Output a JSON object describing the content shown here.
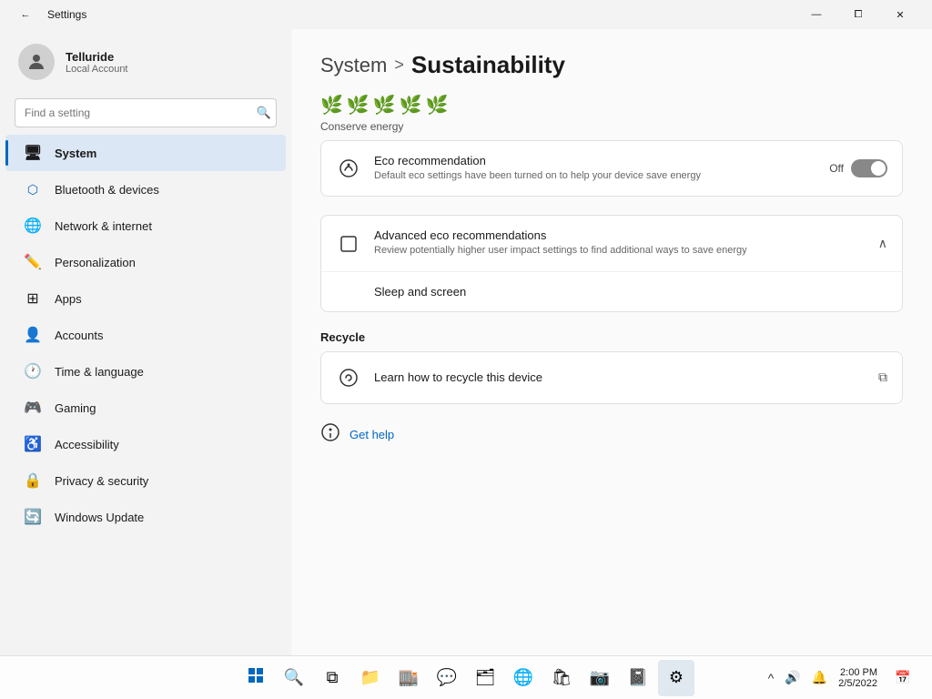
{
  "titleBar": {
    "title": "Settings",
    "backIcon": "←",
    "minimizeIcon": "—",
    "maximizeIcon": "⧠",
    "closeIcon": "✕"
  },
  "sidebar": {
    "profile": {
      "name": "Telluride",
      "type": "Local Account"
    },
    "search": {
      "placeholder": "Find a setting",
      "icon": "🔍"
    },
    "navItems": [
      {
        "id": "system",
        "label": "System",
        "icon": "🖥",
        "active": true
      },
      {
        "id": "bluetooth",
        "label": "Bluetooth & devices",
        "icon": "🔵"
      },
      {
        "id": "network",
        "label": "Network & internet",
        "icon": "🌐"
      },
      {
        "id": "personalization",
        "label": "Personalization",
        "icon": "✏️"
      },
      {
        "id": "apps",
        "label": "Apps",
        "icon": "🟦"
      },
      {
        "id": "accounts",
        "label": "Accounts",
        "icon": "👤"
      },
      {
        "id": "time",
        "label": "Time & language",
        "icon": "🌐"
      },
      {
        "id": "gaming",
        "label": "Gaming",
        "icon": "🎮"
      },
      {
        "id": "accessibility",
        "label": "Accessibility",
        "icon": "♿"
      },
      {
        "id": "privacy",
        "label": "Privacy & security",
        "icon": "🔒"
      },
      {
        "id": "update",
        "label": "Windows Update",
        "icon": "🔄"
      }
    ]
  },
  "main": {
    "breadcrumb": {
      "parent": "System",
      "separator": ">",
      "current": "Sustainability"
    },
    "leafIcons": [
      "🌿",
      "🌿",
      "🌿",
      "🌿",
      "🌿"
    ],
    "conserveSection": {
      "label": "Conserve energy",
      "ecoRecommendation": {
        "title": "Eco recommendation",
        "description": "Default eco settings have been turned on to help your device save energy",
        "toggleLabel": "Off",
        "toggleState": "off"
      },
      "advancedEco": {
        "title": "Advanced eco recommendations",
        "description": "Review potentially higher user impact settings to find additional ways to save energy",
        "subItem": "Sleep and screen"
      }
    },
    "recycleSection": {
      "label": "Recycle",
      "item": {
        "title": "Learn how to recycle this device",
        "externalLink": true
      }
    },
    "getHelp": {
      "label": "Get help"
    }
  },
  "taskbar": {
    "start": "⊞",
    "search": "🔍",
    "taskview": "⧉",
    "apps": [
      {
        "icon": "📁",
        "name": "file-explorer"
      },
      {
        "icon": "🟦",
        "name": "microsoft-store"
      },
      {
        "icon": "💬",
        "name": "teams"
      },
      {
        "icon": "🗂",
        "name": "files"
      },
      {
        "icon": "🌐",
        "name": "edge"
      },
      {
        "icon": "🛍",
        "name": "store"
      },
      {
        "icon": "📷",
        "name": "camera"
      },
      {
        "icon": "📓",
        "name": "notepad"
      },
      {
        "icon": "⚙",
        "name": "settings-gear"
      }
    ],
    "sysIcons": {
      "chevron": "^",
      "sound": "🔊",
      "notification": "🔔"
    },
    "time": "2:00 PM",
    "date": "2/5/2022",
    "calIcon": "📅"
  }
}
